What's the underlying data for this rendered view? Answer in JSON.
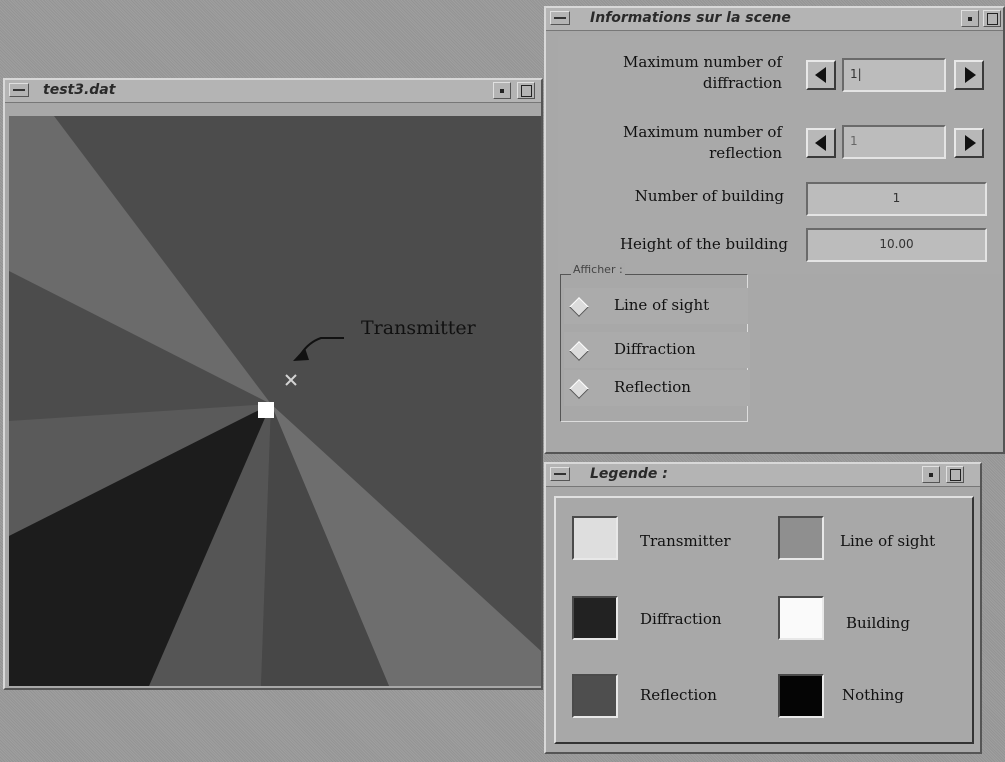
{
  "scene_window": {
    "title": "Informations sur la scene",
    "max_diffraction": {
      "label_line1": "Maximum number of",
      "label_line2": "diffraction",
      "value": "1|"
    },
    "max_reflection": {
      "label_line1": "Maximum number of",
      "label_line2": "reflection",
      "value": "1"
    },
    "num_building": {
      "label": "Number of building",
      "value": "1"
    },
    "building_height": {
      "label": "Height of the building",
      "value": "10.00"
    },
    "display_group": {
      "title": "Afficher :",
      "options": [
        "Line of sight",
        "Diffraction",
        "Reflection"
      ]
    }
  },
  "view_window": {
    "title": "test3.dat",
    "annotation": "Transmitter",
    "colors": {
      "background": "#4c4c4c",
      "line_of_sight": "#6b6b6b",
      "diffraction": "#1c1c1c",
      "reflection": "#555555",
      "building": "#ffffff",
      "transmitter": "#d4d4d4"
    }
  },
  "legend_window": {
    "title": "Legende :",
    "items": [
      {
        "label": "Transmitter",
        "color": "#dedede"
      },
      {
        "label": "Line of sight",
        "color": "#8f8f8f"
      },
      {
        "label": "Diffraction",
        "color": "#222222"
      },
      {
        "label": "Building",
        "color": "#fafafa"
      },
      {
        "label": "Reflection",
        "color": "#4e4e4e"
      },
      {
        "label": "Nothing",
        "color": "#050505"
      }
    ]
  }
}
